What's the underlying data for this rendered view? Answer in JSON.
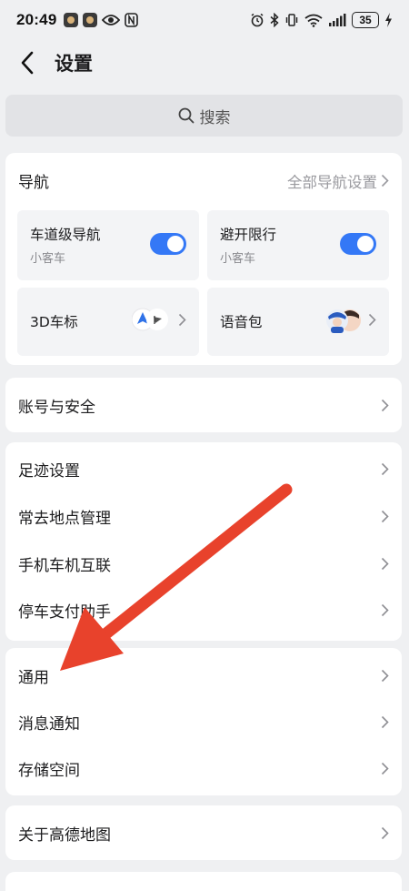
{
  "status_bar": {
    "time": "20:49",
    "battery": "35"
  },
  "header": {
    "title": "设置"
  },
  "search": {
    "placeholder": "搜索"
  },
  "navigation_card": {
    "title": "导航",
    "all_settings_link": "全部导航设置",
    "tiles": [
      {
        "title": "车道级导航",
        "subtitle": "小客车",
        "toggle_on": true
      },
      {
        "title": "避开限行",
        "subtitle": "小客车",
        "toggle_on": true
      },
      {
        "title": "3D车标"
      },
      {
        "title": "语音包"
      }
    ]
  },
  "account_section": {
    "items": [
      {
        "label": "账号与安全"
      }
    ]
  },
  "footprint_section": {
    "items": [
      {
        "label": "足迹设置"
      },
      {
        "label": "常去地点管理"
      },
      {
        "label": "手机车机互联"
      },
      {
        "label": "停车支付助手"
      }
    ]
  },
  "general_section": {
    "items": [
      {
        "label": "通用"
      },
      {
        "label": "消息通知"
      },
      {
        "label": "存储空间"
      }
    ]
  },
  "about_section": {
    "items": [
      {
        "label": "关于高德地图"
      }
    ]
  },
  "colors": {
    "toggle_on": "#3478f6",
    "annotation_arrow": "#e8422c",
    "background": "#eff0f2"
  },
  "icons": [
    "back-icon",
    "search-icon",
    "chevron-right-icon",
    "vehicle-marker-icon",
    "voice-avatar-icon"
  ]
}
